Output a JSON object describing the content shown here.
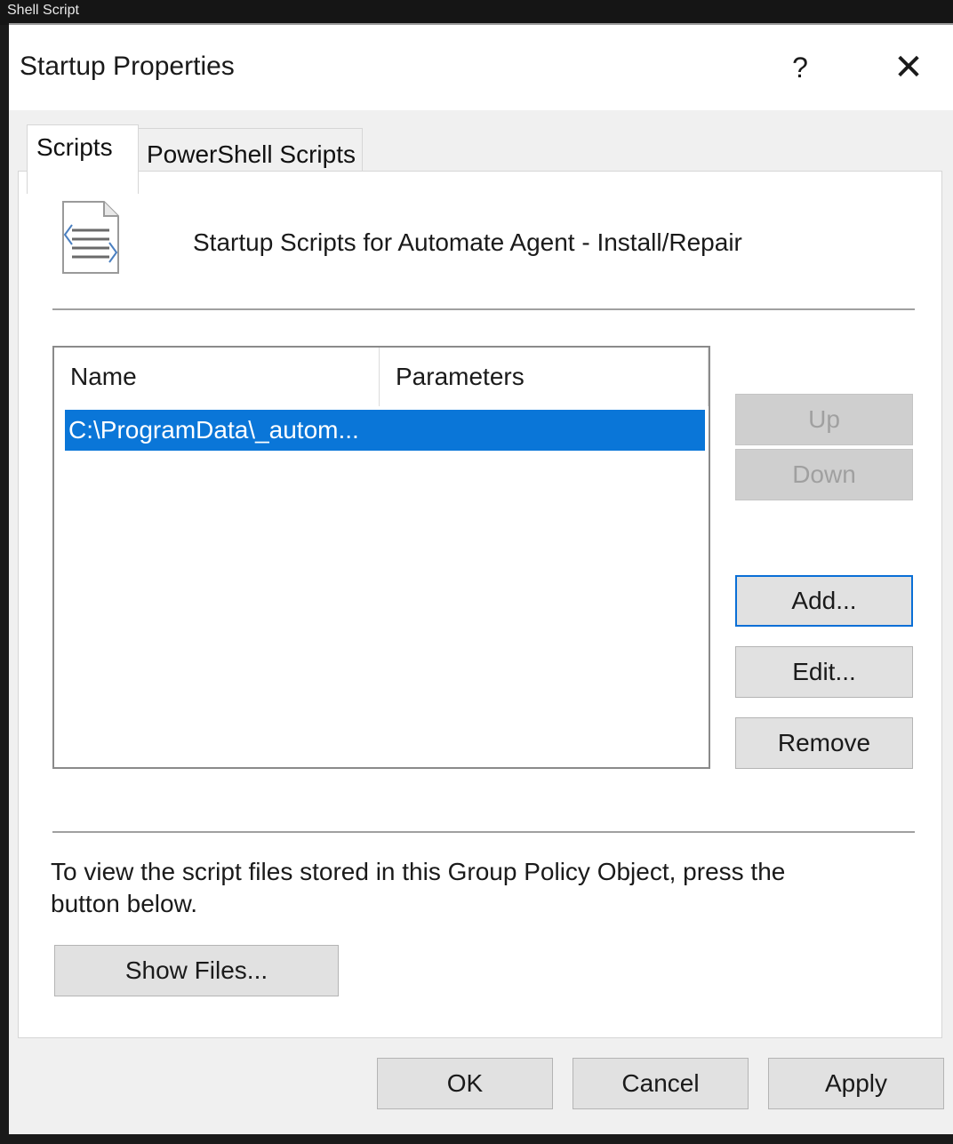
{
  "background_window": {
    "title_fragment": "Shell Script"
  },
  "dialog": {
    "title": "Startup Properties",
    "help_glyph": "?",
    "close_glyph": "✕"
  },
  "tabs": [
    {
      "label": "Scripts",
      "selected": true
    },
    {
      "label": "PowerShell Scripts",
      "selected": false
    }
  ],
  "panel": {
    "heading": "Startup Scripts for Automate Agent - Install/Repair",
    "list": {
      "columns": [
        "Name",
        "Parameters"
      ],
      "rows": [
        {
          "name": "C:\\ProgramData\\_autom...",
          "parameters": "",
          "selected": true
        }
      ]
    },
    "side_buttons": {
      "up": "Up",
      "down": "Down",
      "add": "Add...",
      "edit": "Edit...",
      "remove": "Remove"
    },
    "info_text": "To view the script files stored in this Group Policy Object, press the button below.",
    "show_files_button": "Show Files..."
  },
  "footer_buttons": {
    "ok": "OK",
    "cancel": "Cancel",
    "apply": "Apply"
  },
  "colors": {
    "selection": "#0a76d8",
    "focus_border": "#0a6fd6"
  },
  "icons": {
    "script": "script-file-icon",
    "help": "help-icon",
    "close": "close-icon"
  }
}
